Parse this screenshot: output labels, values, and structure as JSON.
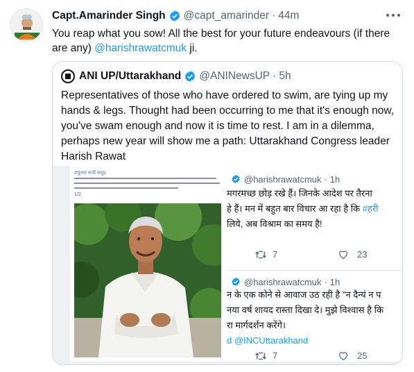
{
  "tweet": {
    "author_name": "Capt.Amarinder Singh",
    "author_handle": "@capt_amarinder",
    "time": "44m",
    "text_before": "You reap what you sow! All the best for your future endeavours (if there are any) ",
    "mention": "@harishrawatcmuk",
    "text_after": " ji.",
    "icons": {
      "verified": "verified-badge-icon",
      "more": "more-icon"
    }
  },
  "quote": {
    "author_name": "ANI UP/Uttarakhand",
    "author_handle": "@ANINewsUP",
    "time": "5h",
    "text": "Representatives of those who have ordered to swim, are tying up my hands & legs. Thought had been occurring to me that it's enough now, you've swam enough and now it is time to rest. I am in a dilemma, perhaps new year will show me a path: Uttarakhand Congress leader Harish Rawat",
    "media": {
      "left_title": "#चुनाव रूपी समुद्र",
      "left_page": "1/2",
      "embedded_1": {
        "handle": "@harishrawatcmuk",
        "time": "1h",
        "line1": "मगरमच्छ छोड़ रखे हैं। जिनके आदेश पर तैरना",
        "line2": "हे हैं। मन में बहुत बार विचार आ रहा है कि",
        "line2_tag": "#हरी",
        "line3": "लिये, अब विश्राम का समय है!",
        "retweets": "7",
        "likes": "23"
      },
      "embedded_2": {
        "handle": "@harishrawatcmuk",
        "time": "1h",
        "line1": "न के एक कोने से आवाज उठ रही है \"न दैन्यं न प",
        "line2": "नया वर्ष शायद रास्ता दिखा दे। मुझे विश्वास है कि",
        "line3": "रा मार्गदर्शन करेंगे।",
        "line4_prefix": "d ",
        "line4_mention": "@INCUttarakhand",
        "retweets": "7",
        "likes": "25"
      }
    }
  },
  "colors": {
    "accent": "#1d9bf0",
    "text": "#0f1419",
    "muted": "#536471",
    "border": "#cfd9de"
  }
}
